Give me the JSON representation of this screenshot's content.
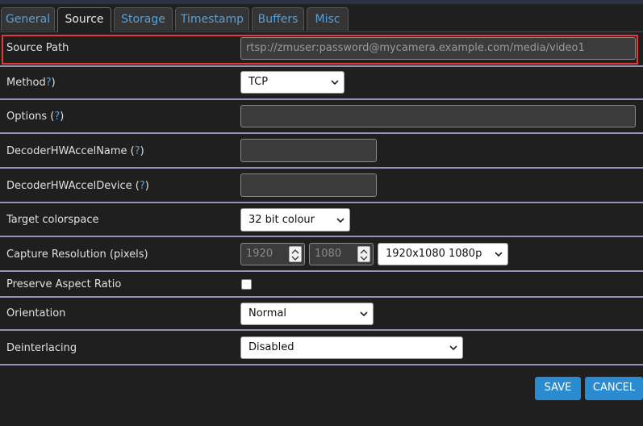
{
  "tabs": [
    {
      "label": "General"
    },
    {
      "label": "Source",
      "active": true
    },
    {
      "label": "Storage"
    },
    {
      "label": "Timestamp"
    },
    {
      "label": "Buffers"
    },
    {
      "label": "Misc"
    }
  ],
  "help_mark": "?",
  "fields": {
    "source_path": {
      "label": "Source Path",
      "value": "rtsp://zmuser:password@mycamera.example.com/media/video1"
    },
    "method": {
      "label": "Method",
      "suffix": ")",
      "value": "TCP"
    },
    "options": {
      "label": "Options (",
      "suffix": ")",
      "value": ""
    },
    "decoder_name": {
      "label": "DecoderHWAccelName (",
      "suffix": ")",
      "value": ""
    },
    "decoder_device": {
      "label": "DecoderHWAccelDevice (",
      "suffix": ")",
      "value": ""
    },
    "colorspace": {
      "label": "Target colorspace",
      "value": "32 bit colour"
    },
    "resolution": {
      "label": "Capture Resolution (pixels)",
      "width": "1920",
      "height": "1080",
      "preset": "1920x1080 1080p"
    },
    "aspect": {
      "label": "Preserve Aspect Ratio",
      "checked": false
    },
    "orientation": {
      "label": "Orientation",
      "value": "Normal"
    },
    "deinterlacing": {
      "label": "Deinterlacing",
      "value": "Disabled"
    }
  },
  "buttons": {
    "save": "SAVE",
    "cancel": "CANCEL"
  },
  "colors": {
    "accent": "#2a8bd1",
    "highlight_border": "#e03a3a",
    "row_separator": "#9391b8"
  }
}
